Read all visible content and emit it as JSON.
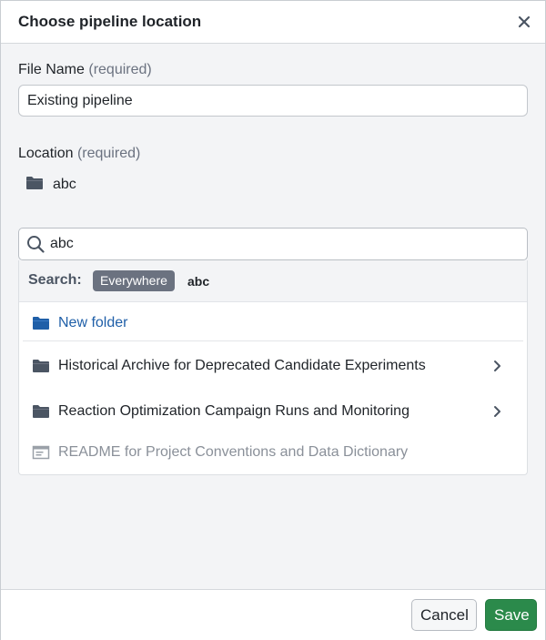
{
  "dialog": {
    "title": "Choose pipeline location",
    "close_icon": "close-icon"
  },
  "file_name": {
    "label": "File Name",
    "required": "(required)",
    "value": "Existing pipeline"
  },
  "location": {
    "label": "Location",
    "required": "(required)",
    "current": "abc",
    "icon": "folder-icon"
  },
  "search": {
    "value": "abc",
    "icon": "search-icon",
    "scope_label": "Search:",
    "scope_badge": "Everywhere",
    "term": "abc"
  },
  "results": {
    "new_folder": "New folder",
    "items": [
      {
        "label": "Historical Archive for Deprecated Candidate Experiments",
        "type": "folder",
        "has_children": true
      },
      {
        "label": "Reaction Optimization Campaign Runs and Monitoring",
        "type": "folder",
        "has_children": true
      },
      {
        "label": "README for Project Conventions and Data Dictionary",
        "type": "document",
        "has_children": false,
        "disabled": true
      }
    ]
  },
  "footer": {
    "cancel_label": "Cancel",
    "save_label": "Save"
  },
  "colors": {
    "accent_blue": "#1f5fa8",
    "save_green": "#2b8a4b",
    "folder_gray": "#4b5563",
    "disabled_gray": "#8a9099"
  }
}
